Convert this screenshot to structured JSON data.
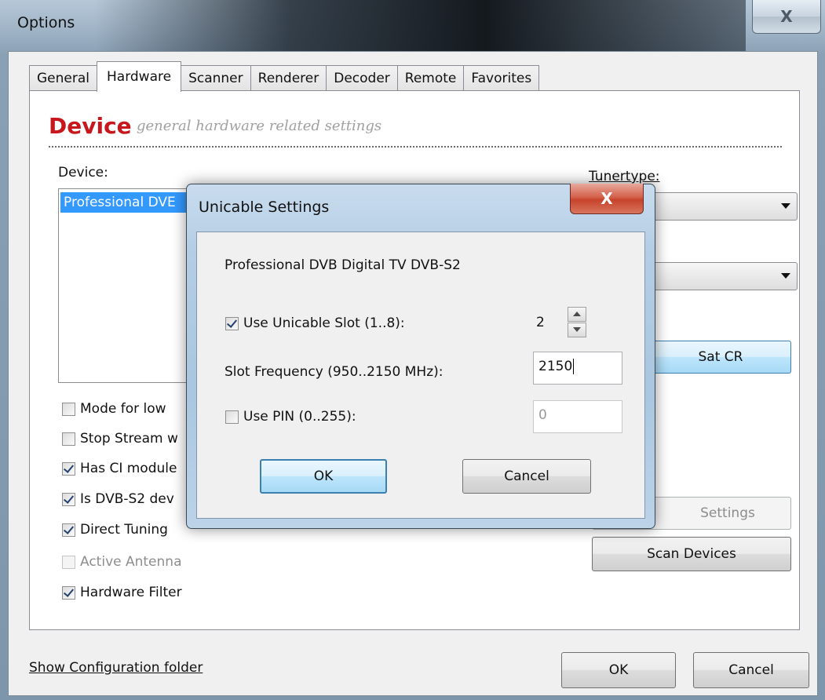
{
  "window": {
    "title": "Options",
    "close_glyph": "X"
  },
  "tabs": [
    {
      "label": "General",
      "active": false
    },
    {
      "label": "Hardware",
      "active": true
    },
    {
      "label": "Scanner",
      "active": false
    },
    {
      "label": "Renderer",
      "active": false
    },
    {
      "label": "Decoder",
      "active": false
    },
    {
      "label": "Remote",
      "active": false
    },
    {
      "label": "Favorites",
      "active": false
    }
  ],
  "section": {
    "title": "Device",
    "subtitle": "general hardware related settings"
  },
  "device": {
    "label": "Device:",
    "list_items": [
      "Professional DVB Digital TV DVB-S2"
    ],
    "list_visible_text": "Professional DVE"
  },
  "tunertype": {
    "label": "Tunertype:",
    "selected": "",
    "second_combo_selected": ""
  },
  "sat_cr_button": "Sat CR",
  "settings_button": "Settings",
  "scan_devices_button": "Scan Devices",
  "options_checkboxes": [
    {
      "label": "Mode for low",
      "checked": false,
      "enabled": true
    },
    {
      "label": "Stop Stream w",
      "checked": false,
      "enabled": true
    },
    {
      "label": "Has CI module",
      "checked": true,
      "enabled": true
    },
    {
      "label": "Is DVB-S2 dev",
      "checked": true,
      "enabled": true
    },
    {
      "label": "Direct Tuning",
      "checked": true,
      "enabled": true
    },
    {
      "label": "Active Antenna",
      "checked": false,
      "enabled": false
    },
    {
      "label": "Hardware Filter",
      "checked": true,
      "enabled": true
    }
  ],
  "footer": {
    "config_link": "Show Configuration folder",
    "ok": "OK",
    "cancel": "Cancel"
  },
  "unicable_dialog": {
    "title": "Unicable Settings",
    "close_glyph": "X",
    "device_name": "Professional DVB Digital TV DVB-S2",
    "use_slot": {
      "label": "Use Unicable Slot (1..8):",
      "checked": true
    },
    "slot_value": "2",
    "slot_frequency": {
      "label": "Slot Frequency (950..2150 MHz):",
      "value": "2150"
    },
    "use_pin": {
      "label": "Use PIN (0..255):",
      "checked": false
    },
    "pin_value": "0",
    "ok": "OK",
    "cancel": "Cancel"
  },
  "colors": {
    "section_title": "#c8171c",
    "selection": "#3399ff",
    "close_red": "#c7432b"
  }
}
